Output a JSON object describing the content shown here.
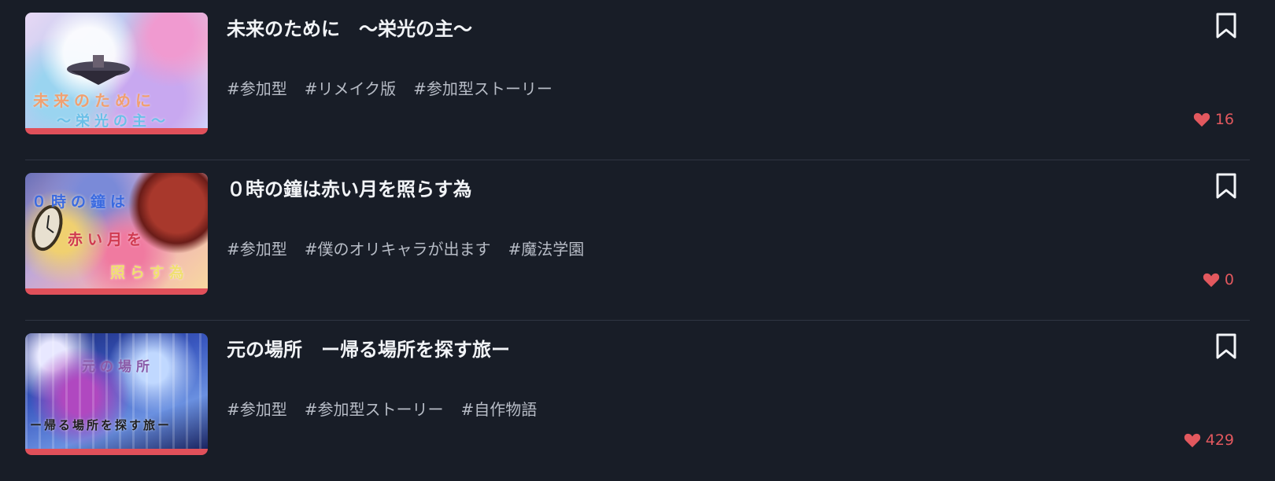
{
  "colors": {
    "background": "#181d27",
    "title": "#f2f4f7",
    "tag": "#b7bcc6",
    "like": "#e2585e",
    "thumb_bar": "#e0505a"
  },
  "stories": [
    {
      "title": "未来のために　〜栄光の主〜",
      "thumb_caption_line1": "未来のために",
      "thumb_caption_line2": "〜栄光の主〜",
      "tags": [
        "#参加型",
        "#リメイク版",
        "#参加型ストーリー"
      ],
      "likes": "16",
      "bookmark_icon": "bookmark-icon",
      "like_icon": "heart-icon"
    },
    {
      "title": "０時の鐘は赤い月を照らす為",
      "thumb_caption_line1": "０時の鐘は",
      "thumb_caption_line2": "赤い月を",
      "thumb_caption_line3": "照らす為",
      "tags": [
        "#参加型",
        "#僕のオリキャラが出ます",
        "#魔法学園"
      ],
      "likes": "0",
      "bookmark_icon": "bookmark-icon",
      "like_icon": "heart-icon"
    },
    {
      "title": "元の場所　ー帰る場所を探す旅ー",
      "thumb_caption_line1": "元の場所",
      "thumb_caption_line2": "ー帰る場所を探す旅ー",
      "tags": [
        "#参加型",
        "#参加型ストーリー",
        "#自作物語"
      ],
      "likes": "429",
      "bookmark_icon": "bookmark-icon",
      "like_icon": "heart-icon"
    }
  ]
}
